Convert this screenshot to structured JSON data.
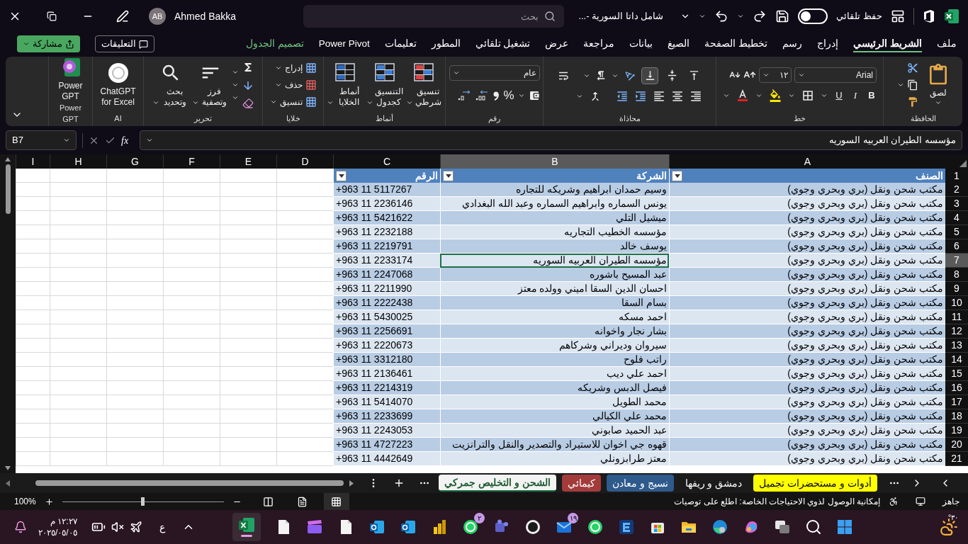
{
  "title_bar": {
    "autosave_label": "حفظ تلقائي",
    "autosave_on": false,
    "file_name": "شامل داتا السورية -...",
    "search_placeholder": "بحث",
    "user_initials": "AB",
    "user_name": "Ahmed Bakka"
  },
  "menu_tabs": [
    {
      "label": "ملف",
      "selected": false,
      "kind": "normal"
    },
    {
      "label": "الشريط الرئيسي",
      "selected": true,
      "kind": "normal"
    },
    {
      "label": "إدراج",
      "selected": false,
      "kind": "normal"
    },
    {
      "label": "رسم",
      "selected": false,
      "kind": "normal"
    },
    {
      "label": "تخطيط الصفحة",
      "selected": false,
      "kind": "normal"
    },
    {
      "label": "الصيغ",
      "selected": false,
      "kind": "normal"
    },
    {
      "label": "بيانات",
      "selected": false,
      "kind": "normal"
    },
    {
      "label": "مراجعة",
      "selected": false,
      "kind": "normal"
    },
    {
      "label": "عرض",
      "selected": false,
      "kind": "normal"
    },
    {
      "label": "تشغيل تلقائي",
      "selected": false,
      "kind": "normal"
    },
    {
      "label": "المطور",
      "selected": false,
      "kind": "normal"
    },
    {
      "label": "تعليمات",
      "selected": false,
      "kind": "normal"
    },
    {
      "label": "Power Pivot",
      "selected": false,
      "kind": "normal"
    },
    {
      "label": "تصميم الجدول",
      "selected": false,
      "kind": "contextual"
    }
  ],
  "comments_button": "التعليقات",
  "share_button": "مشاركة",
  "ribbon": {
    "clipboard": {
      "label": "الحافظة",
      "paste": "لصق"
    },
    "font": {
      "label": "خط",
      "font_name": "Arial",
      "font_size": "١٢",
      "bold": "B",
      "italic": "I",
      "underline": "U"
    },
    "alignment": {
      "label": "محاذاة",
      "vertical": [
        {
          "selected": false
        },
        {
          "selected": false
        },
        {
          "selected": true
        }
      ]
    },
    "number": {
      "label": "رقم",
      "format": "عام",
      "percent": "%"
    },
    "styles": {
      "label": "أنماط",
      "buttons": [
        "تنسيق شرطي",
        "التنسيق كجدول",
        "أنماط الخلايا"
      ]
    },
    "cells": {
      "label": "خلايا",
      "buttons": [
        "إدراج",
        "حذف",
        "تنسيق"
      ]
    },
    "editing": {
      "label": "تحرير",
      "buttons": [
        "فرز وتصفية",
        "بحث وتحديد"
      ]
    },
    "ai": {
      "label": "AI",
      "button": "ChatGPT for Excel"
    },
    "power_gpt": {
      "label": "Power GPT",
      "button": "Power GPT"
    }
  },
  "formula_bar": {
    "name_box": "B7",
    "fx": "fx",
    "value": "مؤسسه الطيران العربيه السوريه"
  },
  "sheet": {
    "columns": [
      {
        "letter": "A",
        "selected": false
      },
      {
        "letter": "B",
        "selected": true
      },
      {
        "letter": "C",
        "selected": false
      },
      {
        "letter": "D",
        "selected": false
      },
      {
        "letter": "E",
        "selected": false
      },
      {
        "letter": "F",
        "selected": false
      },
      {
        "letter": "G",
        "selected": false
      },
      {
        "letter": "H",
        "selected": false
      },
      {
        "letter": "I",
        "selected": false
      }
    ],
    "header_row": {
      "number": "1",
      "cells": [
        "الصنف",
        "الشركة",
        "الرقم"
      ]
    },
    "rows": [
      {
        "number": "2",
        "selected": false,
        "cells": [
          "مكتب شحن ونقل (بري وبحري وجوي)",
          "وسيم حمدان ابراهيم وشريكه للتجاره",
          "+963 11 5117267"
        ]
      },
      {
        "number": "3",
        "selected": false,
        "cells": [
          "مكتب شحن ونقل (بري وبحري وجوي)",
          "يونس السماره وابراهيم السماره وعبد الله البغدادي",
          "+963 11 2236146"
        ]
      },
      {
        "number": "4",
        "selected": false,
        "cells": [
          "مكتب شحن ونقل (بري وبحري وجوي)",
          "ميشيل التلي",
          "+963 11 5421622"
        ]
      },
      {
        "number": "5",
        "selected": false,
        "cells": [
          "مكتب شحن ونقل (بري وبحري وجوي)",
          "مؤسسه الخطيب التجاريه",
          "+963 11 2232188"
        ]
      },
      {
        "number": "6",
        "selected": false,
        "cells": [
          "مكتب شحن ونقل (بري وبحري وجوي)",
          "يوسف خالد",
          "+963 11 2219791"
        ]
      },
      {
        "number": "7",
        "selected": true,
        "cells": [
          "مكتب شحن ونقل (بري وبحري وجوي)",
          "مؤسسه الطيران العربيه السوريه",
          "+963 11 2233174"
        ]
      },
      {
        "number": "8",
        "selected": false,
        "cells": [
          "مكتب شحن ونقل (بري وبحري وجوي)",
          "عبد المسيح باشوره",
          "+963 11 2247068"
        ]
      },
      {
        "number": "9",
        "selected": false,
        "cells": [
          "مكتب شحن ونقل (بري وبحري وجوي)",
          "احسان الدين السقا اميني وولده معتز",
          "+963 11 2211990"
        ]
      },
      {
        "number": "10",
        "selected": false,
        "cells": [
          "مكتب شحن ونقل (بري وبحري وجوي)",
          "بسام السقا",
          "+963 11 2222438"
        ]
      },
      {
        "number": "11",
        "selected": false,
        "cells": [
          "مكتب شحن ونقل (بري وبحري وجوي)",
          "احمد مسكه",
          "+963 11 5430025"
        ]
      },
      {
        "number": "12",
        "selected": false,
        "cells": [
          "مكتب شحن ونقل (بري وبحري وجوي)",
          "بشار نجار واخوانه",
          "+963 11 2256691"
        ]
      },
      {
        "number": "13",
        "selected": false,
        "cells": [
          "مكتب شحن ونقل (بري وبحري وجوي)",
          "سيروان وديراني وشركاهم",
          "+963 11 2220673"
        ]
      },
      {
        "number": "14",
        "selected": false,
        "cells": [
          "مكتب شحن ونقل (بري وبحري وجوي)",
          "راتب فلوح",
          "+963 11 3312180"
        ]
      },
      {
        "number": "15",
        "selected": false,
        "cells": [
          "مكتب شحن ونقل (بري وبحري وجوي)",
          "احمد علي ديب",
          "+963 11 2136461"
        ]
      },
      {
        "number": "16",
        "selected": false,
        "cells": [
          "مكتب شحن ونقل (بري وبحري وجوي)",
          "فيصل الدبس وشريكه",
          "+963 11 2214319"
        ]
      },
      {
        "number": "17",
        "selected": false,
        "cells": [
          "مكتب شحن ونقل (بري وبحري وجوي)",
          "محمد الطويل",
          "+963 11 5414070"
        ]
      },
      {
        "number": "18",
        "selected": false,
        "cells": [
          "مكتب شحن ونقل (بري وبحري وجوي)",
          "محمد علي الكيالي",
          "+963 11 2233699"
        ]
      },
      {
        "number": "19",
        "selected": false,
        "cells": [
          "مكتب شحن ونقل (بري وبحري وجوي)",
          "عبد الحميد صابوني",
          "+963 11 2243053"
        ]
      },
      {
        "number": "20",
        "selected": false,
        "cells": [
          "مكتب شحن ونقل (بري وبحري وجوي)",
          "قهوه جي اخوان للاستيراد والتصدير والنقل والترانزيت",
          "+963 11 4727223"
        ]
      },
      {
        "number": "21",
        "selected": false,
        "cells": [
          "مكتب شحن ونقل (بري وبحري وجوي)",
          "معتز طرابزونلي",
          "+963 11 4442649"
        ]
      }
    ]
  },
  "sheet_tabs": [
    {
      "label": "أدوات و مستحضرات تجميل",
      "selected": false,
      "color": "#ffff00"
    },
    {
      "label": "دمشق و ريفها",
      "selected": false
    },
    {
      "label": "نسيج و معادن",
      "selected": false,
      "color": "#2e5a8c"
    },
    {
      "label": "كيمائي",
      "selected": false,
      "color": "#a33b3b"
    },
    {
      "label": "الشحن و التخليص جمركي",
      "selected": true
    }
  ],
  "status_bar": {
    "ready": "جاهز",
    "accessibility": "إمكانية الوصول لذوي الاحتياجات الخاصة: اطلع على توصيات",
    "view_buttons": [
      {
        "selected": true
      },
      {
        "selected": false
      },
      {
        "selected": false
      }
    ],
    "zoom": {
      "level": 0.5,
      "reading": "100%"
    }
  },
  "taskbar": {
    "temperature": "٣٠°",
    "mail_badge": "١٩",
    "chat_badge": "٢",
    "language": "ع",
    "time": "١٢:٢٧ م",
    "date": "٢٠٢٥/٠٥/٠٥"
  }
}
